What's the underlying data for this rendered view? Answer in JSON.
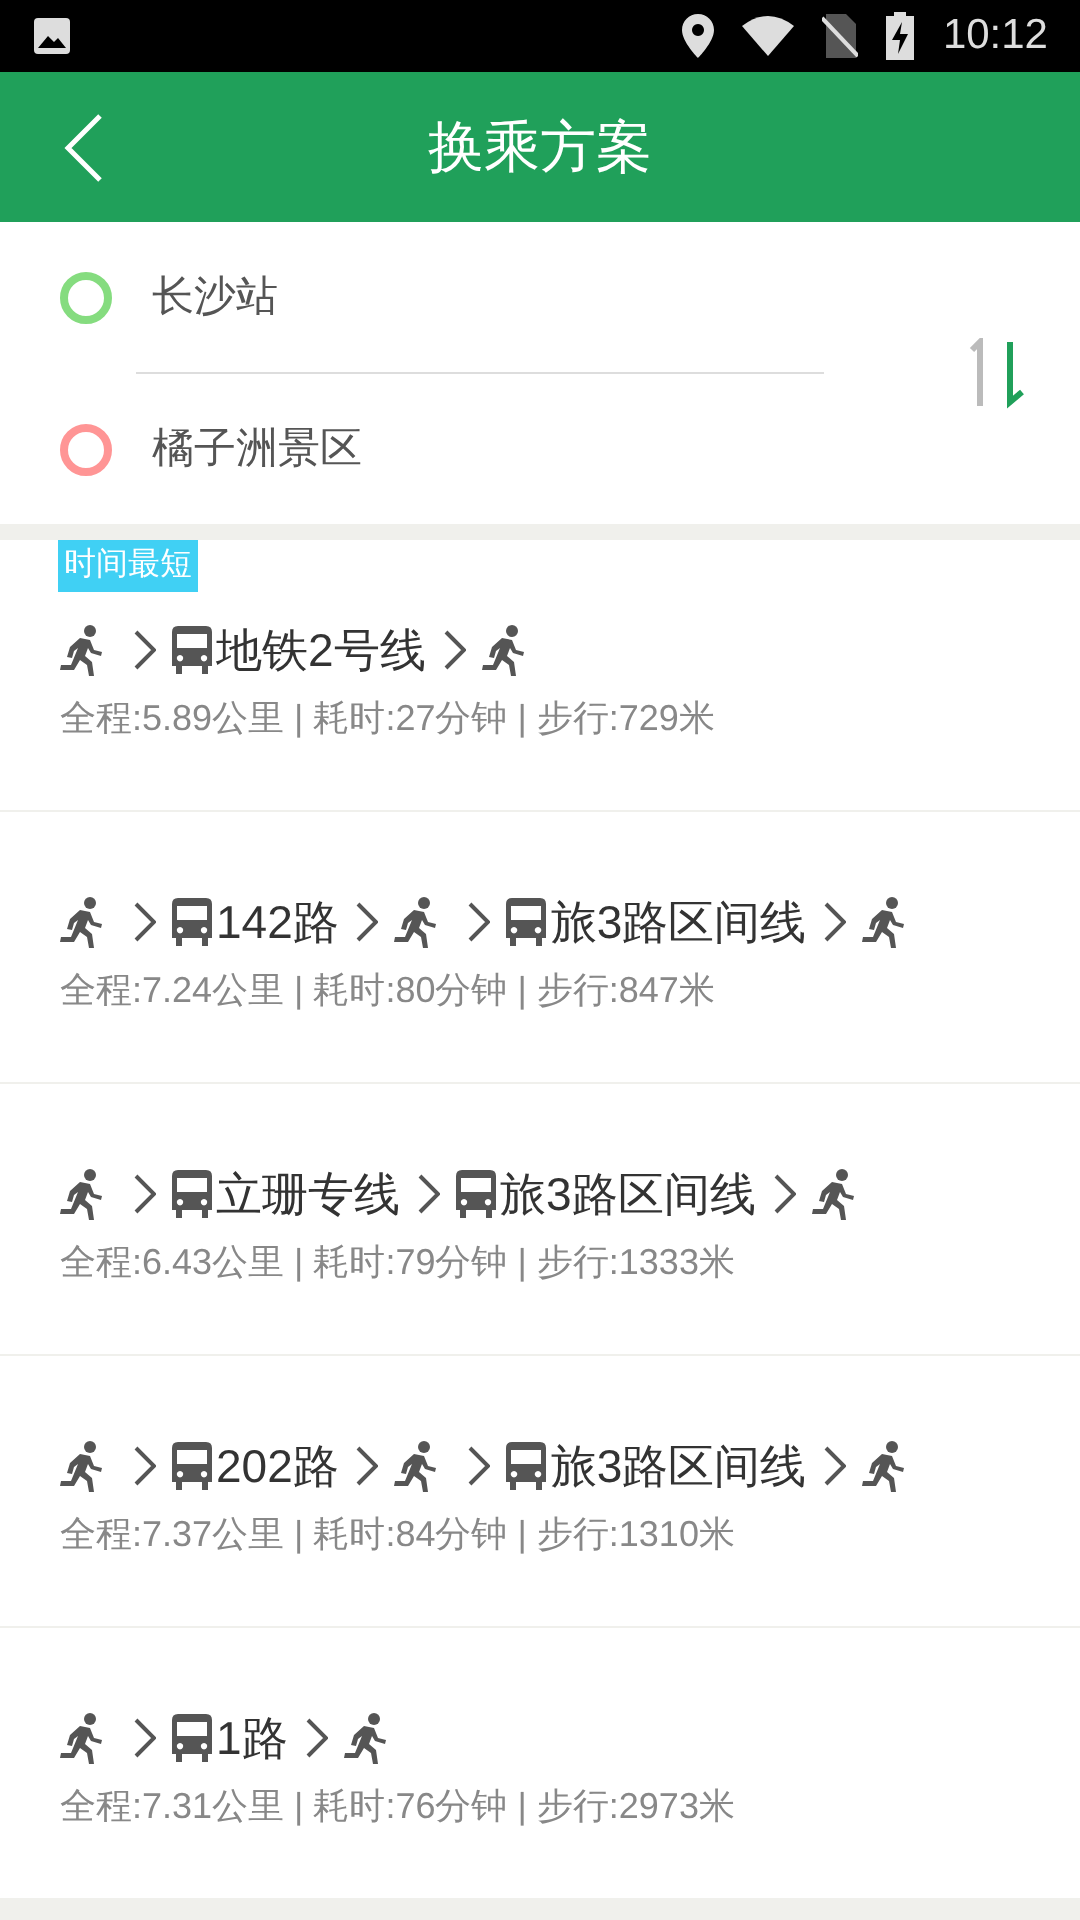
{
  "status_bar": {
    "time": "10:12"
  },
  "header": {
    "title": "换乘方案"
  },
  "trip": {
    "origin": "长沙站",
    "destination": "橘子洲景区"
  },
  "routes": [
    {
      "badge": "时间最短",
      "steps": [
        {
          "kind": "walk"
        },
        {
          "kind": "bus",
          "label": "地铁2号线"
        },
        {
          "kind": "walk"
        }
      ],
      "summary": "全程:5.89公里 | 耗时:27分钟 | 步行:729米"
    },
    {
      "steps": [
        {
          "kind": "walk"
        },
        {
          "kind": "bus",
          "label": "142路"
        },
        {
          "kind": "walk"
        },
        {
          "kind": "bus",
          "label": "旅3路区间线"
        },
        {
          "kind": "walk"
        }
      ],
      "summary": "全程:7.24公里 | 耗时:80分钟 | 步行:847米"
    },
    {
      "steps": [
        {
          "kind": "walk"
        },
        {
          "kind": "bus",
          "label": "立珊专线"
        },
        {
          "kind": "bus",
          "label": "旅3路区间线"
        },
        {
          "kind": "walk"
        }
      ],
      "summary": "全程:6.43公里 | 耗时:79分钟 | 步行:1333米"
    },
    {
      "steps": [
        {
          "kind": "walk"
        },
        {
          "kind": "bus",
          "label": "202路"
        },
        {
          "kind": "walk"
        },
        {
          "kind": "bus",
          "label": "旅3路区间线"
        },
        {
          "kind": "walk"
        }
      ],
      "summary": "全程:7.37公里 | 耗时:84分钟 | 步行:1310米"
    },
    {
      "steps": [
        {
          "kind": "walk"
        },
        {
          "kind": "bus",
          "label": "1路"
        },
        {
          "kind": "walk"
        }
      ],
      "summary": "全程:7.31公里 | 耗时:76分钟 | 步行:2973米"
    }
  ]
}
